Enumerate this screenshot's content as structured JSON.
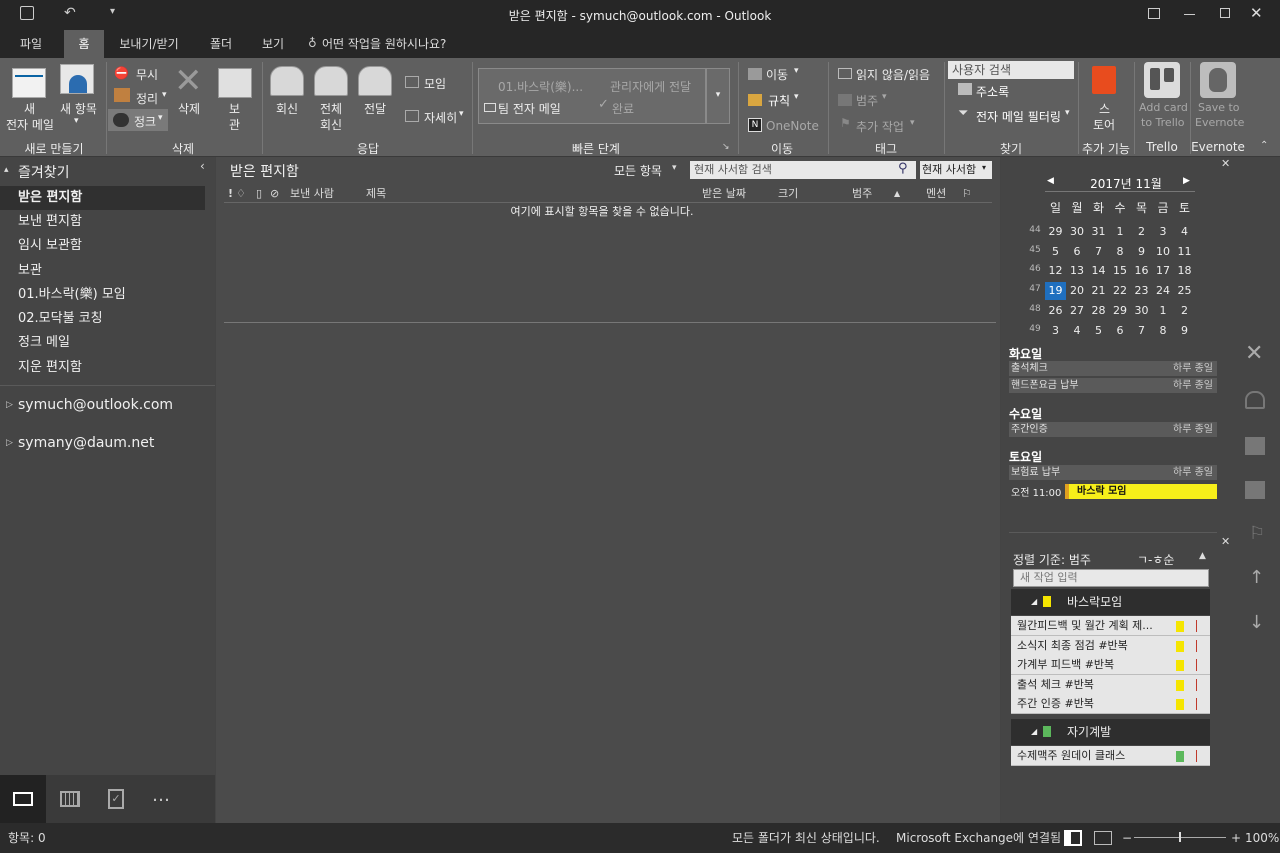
{
  "window": {
    "title": "받은 편지함 - symuch@outlook.com  -  Outlook"
  },
  "tabs": [
    "파일",
    "홈",
    "보내기/받기",
    "폴더",
    "보기"
  ],
  "tell_me": "어떤 작업을 원하시나요?",
  "ribbon": {
    "new": {
      "new_email_l1": "새",
      "new_email_l2": "전자 메일",
      "new_items_l1": "새 항목",
      "group": "새로 만들기"
    },
    "delete": {
      "ignore": "무시",
      "cleanup": "정리",
      "junk": "정크",
      "delete": "삭제",
      "archive_l1": "보",
      "archive_l2": "관",
      "group": "삭제"
    },
    "respond": {
      "reply": "회신",
      "reply_all_l1": "전체",
      "reply_all_l2": "회신",
      "forward": "전달",
      "meeting": "모임",
      "more": "자세히",
      "group": "응답"
    },
    "quicksteps": {
      "item1": "01.바스락(樂)...",
      "item2": "관리자에게 전달",
      "item3": "팀 전자 메일",
      "item4": "완료",
      "group": "빠른 단계"
    },
    "move": {
      "move": "이동",
      "rules": "규칙",
      "onenote": "OneNote",
      "group": "이동"
    },
    "tags": {
      "unread": "읽지 않음/읽음",
      "categorize": "범주",
      "followup": "추가 작업",
      "group": "태그"
    },
    "find": {
      "search_people": "사용자 검색",
      "addressbook": "주소록",
      "filter": "전자 메일 필터링",
      "group": "찾기"
    },
    "addins": {
      "store_l1": "스",
      "store_l2": "토어",
      "group": "추가 기능"
    },
    "trello": {
      "l1": "Add card",
      "l2": "to Trello",
      "group": "Trello"
    },
    "evernote": {
      "l1": "Save to",
      "l2": "Evernote",
      "group": "Evernote"
    }
  },
  "nav": {
    "favorites_title": "즐겨찾기",
    "folders": [
      "받은 편지함",
      "보낸 편지함",
      "임시 보관함",
      "보관",
      "01.바스락(樂) 모임",
      "02.모닥불 코칭",
      "정크 메일",
      "지운 편지함"
    ],
    "accounts": [
      "symuch@outlook.com",
      "symany@daum.net"
    ]
  },
  "mail": {
    "folder_title": "받은 편지함",
    "filter": "모든 항목",
    "search_placeholder": "현재 사서함 검색",
    "scope": "현재 사서함",
    "columns": {
      "from": "보낸 사람",
      "subject": "제목",
      "received": "받은 날짜",
      "size": "크기",
      "category": "범주",
      "mention": "멘션"
    },
    "empty": "여기에 표시할 항목을 찾을 수 없습니다."
  },
  "calendar": {
    "month": "2017년 11월",
    "weekdays": [
      "일",
      "월",
      "화",
      "수",
      "목",
      "금",
      "토"
    ],
    "weeks": [
      [
        "44",
        "29",
        "30",
        "31",
        "1",
        "2",
        "3",
        "4"
      ],
      [
        "45",
        "5",
        "6",
        "7",
        "8",
        "9",
        "10",
        "11"
      ],
      [
        "46",
        "12",
        "13",
        "14",
        "15",
        "16",
        "17",
        "18"
      ],
      [
        "47",
        "19",
        "20",
        "21",
        "22",
        "23",
        "24",
        "25"
      ],
      [
        "48",
        "26",
        "27",
        "28",
        "29",
        "30",
        "1",
        "2"
      ],
      [
        "49",
        "3",
        "4",
        "5",
        "6",
        "7",
        "8",
        "9"
      ]
    ],
    "today": "19"
  },
  "agenda": [
    {
      "day": "화요일",
      "items": [
        {
          "title": "출석체크",
          "time": "하루 종일"
        },
        {
          "title": "핸드폰요금 납부",
          "time": "하루 종일"
        }
      ]
    },
    {
      "day": "수요일",
      "items": [
        {
          "title": "주간인증",
          "time": "하루 종일"
        }
      ]
    },
    {
      "day": "토요일",
      "items": [
        {
          "title": "보험료 납부",
          "time": "하루 종일"
        },
        {
          "title": "바스락 모임",
          "time": "오전 11:00"
        }
      ]
    }
  ],
  "tasks": {
    "sort_label": "정렬 기준: 범주",
    "sort_order": "ㄱ-ㅎ순",
    "new_task_placeholder": "새 작업 입력",
    "groups": [
      {
        "name": "바스락모임",
        "color": "#f5e500",
        "items": [
          "월간피드백 및 월간 계획 제...",
          "소식지 최종 점검 #반복",
          "가계부 피드백 #반복",
          "출석 체크 #반복",
          "주간 인증 #반복"
        ]
      },
      {
        "name": "자기계발",
        "color": "#5cb85c",
        "items": [
          "수제맥주 원데이 클래스"
        ]
      }
    ]
  },
  "status": {
    "items": "항목: 0",
    "sync": "모든 폴더가 최신 상태입니다.",
    "connection": "Microsoft Exchange에 연결됨",
    "zoom": "100%"
  }
}
